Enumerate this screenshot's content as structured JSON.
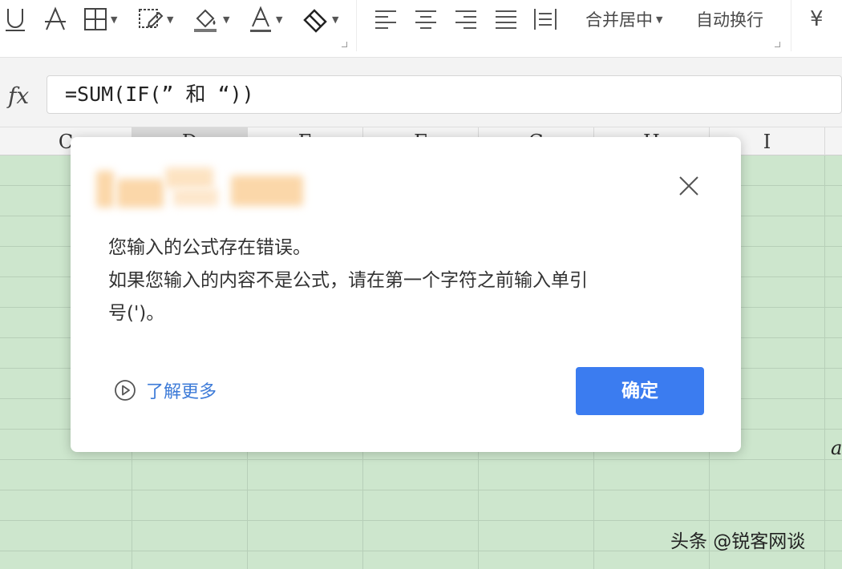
{
  "toolbar": {
    "merge_center_label": "合并居中",
    "auto_wrap_label": "自动换行",
    "currency_symbol": "¥",
    "accent_underline_color": "#555555"
  },
  "formula_bar": {
    "fx_label": "fx",
    "formula_value": "=SUM(IF(” 和 “))"
  },
  "columns": [
    "C",
    "D",
    "E",
    "F",
    "G",
    "H",
    "I"
  ],
  "grid": {
    "cell_color": "#cde6cd",
    "partial_cell_text": "a"
  },
  "dialog": {
    "title_redacted": true,
    "message_lines": [
      "您输入的公式存在错误。",
      "如果您输入的内容不是公式，请在第一个字符之前输入单引",
      "号(')。"
    ],
    "learn_more_label": "了解更多",
    "confirm_label": "确定",
    "confirm_color": "#3b7cf0",
    "link_color": "#3d7bd8"
  },
  "watermark": {
    "text": "头条 @锐客网谈"
  }
}
